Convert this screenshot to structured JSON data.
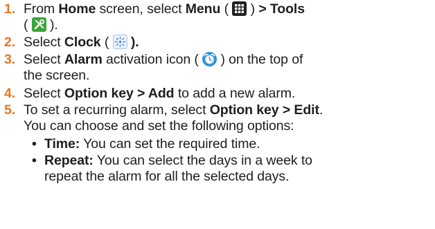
{
  "colors": {
    "step_number": "#e87722",
    "text": "#1e1e1e"
  },
  "icons": {
    "menu": "menu-grid-icon",
    "tools": "tools-icon",
    "clock": "clock-icon",
    "alarm": "alarm-clock-icon"
  },
  "steps": [
    {
      "num": "1.",
      "pre": "From ",
      "home": "Home",
      "mid": " screen, select ",
      "menu": "Menu",
      "open1": " ( ",
      "close1": " ) ",
      "tools": "> Tools",
      "open2": "( ",
      "close2": " )."
    },
    {
      "num": "2.",
      "pre": "Select ",
      "clock": "Clock",
      "open": " ( ",
      "close": " )."
    },
    {
      "num": "3.",
      "pre": "Select ",
      "alarm": "Alarm",
      "mid": " activation icon ( ",
      "post": " ) on the top of",
      "cont": "the screen."
    },
    {
      "num": "4.",
      "pre": "Select ",
      "bold": "Option key > Add",
      "post": " to add a new alarm."
    },
    {
      "num": "5.",
      "pre": "To set a recurring alarm, select ",
      "bold": "Option key > Edit",
      "post": ".",
      "cont": "You can choose and set the following options:"
    }
  ],
  "bullets": [
    {
      "dot": "•",
      "label": "Time:",
      "text": " You can set the required time."
    },
    {
      "dot": "•",
      "label": "Repeat:",
      "text": " You can select the days in a week to",
      "cont": "repeat the alarm for all the selected days."
    }
  ]
}
